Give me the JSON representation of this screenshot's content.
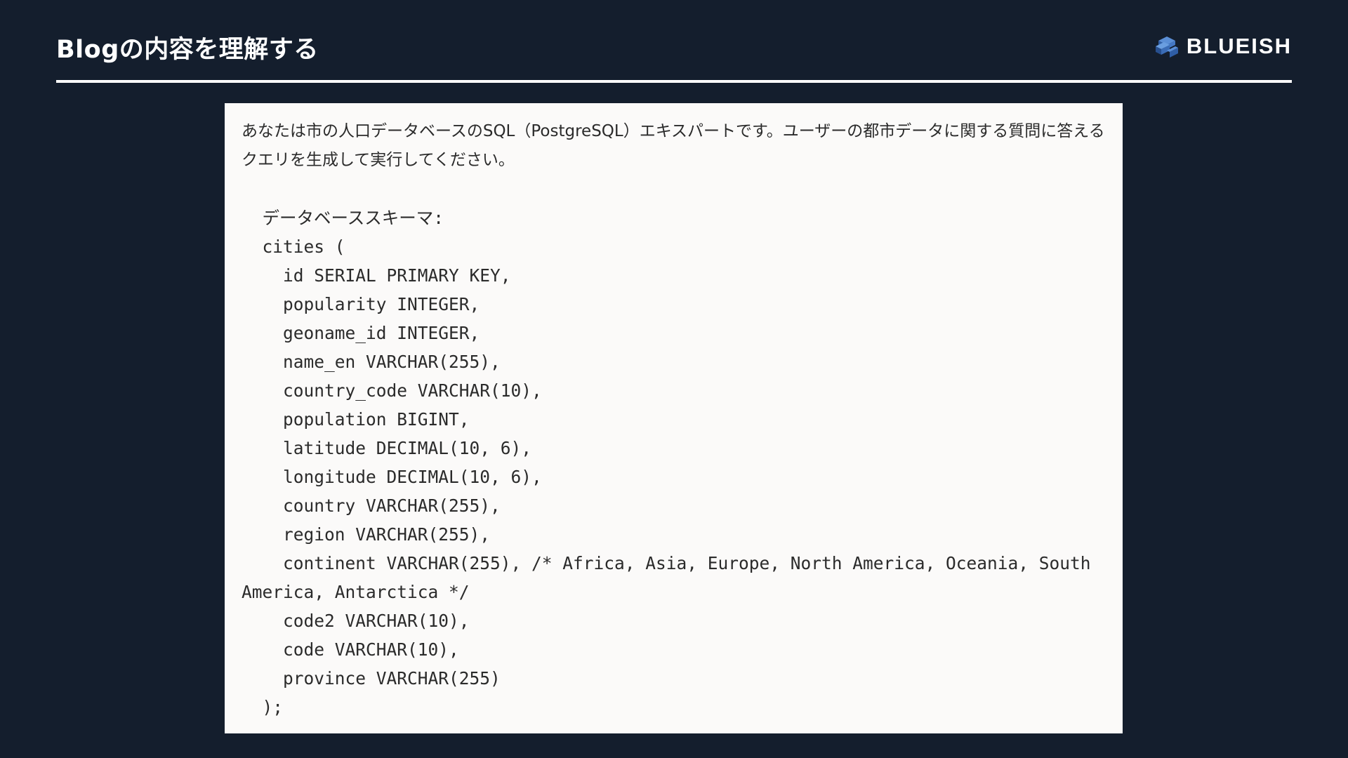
{
  "header": {
    "title": "Blogの内容を理解する",
    "logo_text": "BLUEISH",
    "logo_icon": "stacked-cubes-icon"
  },
  "colors": {
    "background": "#141e2d",
    "panel": "#fbfaf9",
    "text": "#2b2b2b",
    "logo_blue": "#3d6fb6"
  },
  "prompt": {
    "intro": "あなたは市の人口データベースのSQL（PostgreSQL）エキスパートです。ユーザーの都市データに関する質問に答えるクエリを生成して実行してください。",
    "code_lines": [
      "  データベーススキーマ:",
      "  cities (",
      "    id SERIAL PRIMARY KEY,",
      "    popularity INTEGER,",
      "    geoname_id INTEGER,",
      "    name_en VARCHAR(255),",
      "    country_code VARCHAR(10),",
      "    population BIGINT,",
      "    latitude DECIMAL(10, 6),",
      "    longitude DECIMAL(10, 6),",
      "    country VARCHAR(255),",
      "    region VARCHAR(255),",
      "    continent VARCHAR(255), /* Africa, Asia, Europe, North America, Oceania, South America, Antarctica */",
      "    code2 VARCHAR(10),",
      "    code VARCHAR(10),",
      "    province VARCHAR(255)",
      "  );"
    ]
  }
}
